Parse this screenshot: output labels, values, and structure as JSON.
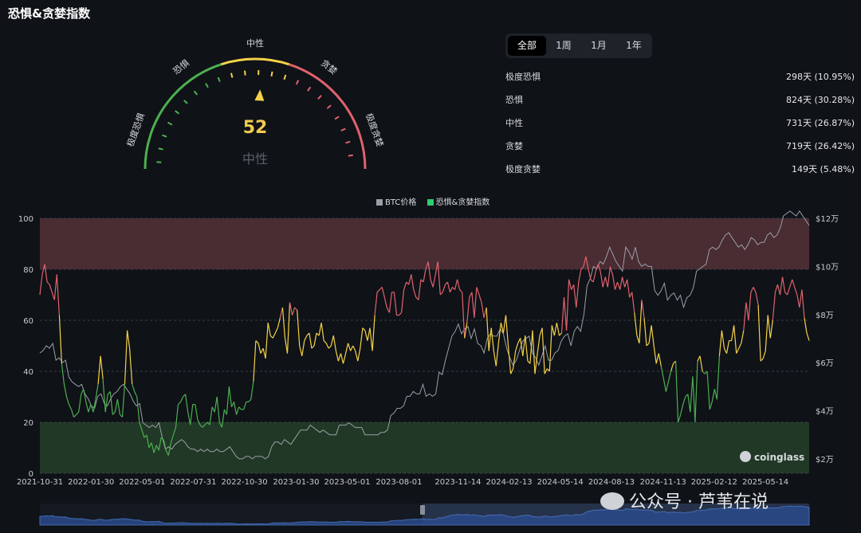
{
  "title": "恐惧&贪婪指数",
  "gauge": {
    "value": "52",
    "status": "中性",
    "labels": [
      "极度恐惧",
      "恐惧",
      "中性",
      "贪婪",
      "极度贪婪"
    ],
    "colors": {
      "extreme_fear": "#4caf50",
      "fear": "#4caf50",
      "neutral": "#f5d247",
      "greed": "#e0626e",
      "extreme_greed": "#e0626e"
    }
  },
  "tabs": [
    "全部",
    "1周",
    "1月",
    "1年"
  ],
  "active_tab": "全部",
  "stats": [
    {
      "label": "极度恐惧",
      "value": "298天 (10.95%)"
    },
    {
      "label": "恐惧",
      "value": "824天 (30.28%)"
    },
    {
      "label": "中性",
      "value": "731天 (26.87%)"
    },
    {
      "label": "贪婪",
      "value": "719天 (26.42%)"
    },
    {
      "label": "极度贪婪",
      "value": "149天 (5.48%)"
    }
  ],
  "chart_data": {
    "type": "line",
    "legend": [
      "BTC价格",
      "恐惧&贪婪指数"
    ],
    "y_left_ticks": [
      "100",
      "80",
      "60",
      "40",
      "20",
      "0"
    ],
    "y_left_range": [
      0,
      100
    ],
    "y_right_ticks": [
      "$12万",
      "$10万",
      "$8万",
      "$6万",
      "$4万",
      "$2万"
    ],
    "y_right_range": [
      10000,
      116000
    ],
    "x_ticks": [
      "2021-10-31",
      "2022-01-30",
      "2022-05-01",
      "2022-07-31",
      "2022-10-30",
      "2023-01-30",
      "2023-05-01",
      "2023-08-01",
      "2023-11-14",
      "2024-02-13",
      "2024-05-14",
      "2024-08-13",
      "2024-11-13",
      "2025-02-12",
      "2025-05-14"
    ],
    "zones": [
      {
        "name": "greed",
        "from": 80,
        "to": 100,
        "color": "#4a2c33"
      },
      {
        "name": "fear",
        "from": 0,
        "to": 20,
        "color": "#213826"
      }
    ],
    "index_colors": {
      "fear": "#4caf50",
      "neutral": "#f5d247",
      "greed": "#e0626e"
    },
    "fgi_series": {
      "name": "恐惧&贪婪指数",
      "values": [
        70,
        78,
        82,
        75,
        74,
        71,
        68,
        78,
        62,
        43,
        35,
        30,
        27,
        25,
        22,
        23,
        24,
        31,
        33,
        28,
        24,
        27,
        24,
        29,
        35,
        46,
        37,
        24,
        31,
        32,
        23,
        24,
        29,
        23,
        22,
        35,
        56,
        49,
        35,
        32,
        30,
        20,
        17,
        14,
        15,
        10,
        12,
        8,
        11,
        9,
        14,
        13,
        9,
        7,
        12,
        15,
        18,
        27,
        28,
        30,
        31,
        24,
        19,
        27,
        27,
        21,
        19,
        18,
        19,
        20,
        19,
        26,
        24,
        30,
        20,
        18,
        25,
        23,
        34,
        26,
        28,
        23,
        26,
        25,
        25,
        28,
        28,
        29,
        36,
        52,
        51,
        47,
        49,
        45,
        59,
        54,
        53,
        55,
        57,
        61,
        65,
        53,
        47,
        67,
        62,
        65,
        64,
        50,
        46,
        52,
        54,
        55,
        49,
        50,
        55,
        54,
        59,
        52,
        51,
        49,
        50,
        54,
        48,
        44,
        47,
        43,
        47,
        51,
        48,
        50,
        48,
        44,
        49,
        57,
        56,
        52,
        57,
        48,
        62,
        71,
        72,
        73,
        69,
        65,
        63,
        71,
        71,
        62,
        62,
        63,
        72,
        75,
        74,
        78,
        72,
        69,
        68,
        76,
        75,
        80,
        83,
        76,
        73,
        78,
        83,
        70,
        71,
        74,
        75,
        71,
        73,
        72,
        76,
        72,
        71,
        53,
        59,
        69,
        71,
        61,
        73,
        70,
        67,
        61,
        65,
        48,
        57,
        48,
        42,
        51,
        59,
        55,
        62,
        50,
        39,
        41,
        48,
        51,
        53,
        46,
        54,
        44,
        43,
        56,
        39,
        47,
        54,
        57,
        39,
        41,
        40,
        58,
        54,
        59,
        54,
        55,
        69,
        56,
        76,
        72,
        74,
        65,
        75,
        80,
        81,
        85,
        80,
        76,
        75,
        79,
        82,
        79,
        73,
        77,
        73,
        81,
        78,
        72,
        75,
        72,
        77,
        73,
        76,
        69,
        71,
        63,
        54,
        51,
        68,
        61,
        50,
        51,
        58,
        50,
        43,
        47,
        42,
        37,
        32,
        36,
        40,
        43,
        44,
        20,
        23,
        27,
        30,
        31,
        24,
        38,
        20,
        44,
        46,
        40,
        39,
        40,
        25,
        28,
        33,
        29,
        46,
        56,
        49,
        47,
        52,
        52,
        58,
        47,
        49,
        51,
        56,
        67,
        60,
        71,
        73,
        71,
        66,
        44,
        45,
        48,
        62,
        53,
        60,
        71,
        74,
        70,
        77,
        71,
        70,
        73,
        76,
        73,
        70,
        65,
        72,
        61,
        55,
        52
      ],
      "first_date": "2021-10-31",
      "last_date": "2025-07-31"
    },
    "btc_series": {
      "name": "BTC价格",
      "values": [
        60000,
        61000,
        63000,
        62000,
        64000,
        57000,
        58000,
        56000,
        57000,
        50000,
        48000,
        47000,
        46000,
        47000,
        43000,
        41000,
        38000,
        37000,
        42000,
        43000,
        39000,
        38000,
        41000,
        43000,
        44000,
        46000,
        47000,
        45000,
        43000,
        40000,
        38000,
        39000,
        31000,
        30000,
        29000,
        30000,
        29000,
        31000,
        25000,
        20000,
        21000,
        20000,
        22000,
        23000,
        24000,
        23000,
        21000,
        20000,
        20000,
        19000,
        20000,
        19000,
        20000,
        19000,
        19000,
        20000,
        19000,
        19000,
        20000,
        21000,
        19000,
        17000,
        16000,
        16000,
        17000,
        17000,
        16000,
        17000,
        17000,
        17000,
        16000,
        17000,
        21000,
        23000,
        23000,
        22000,
        24000,
        23000,
        22000,
        24000,
        26000,
        28000,
        28000,
        28000,
        30000,
        29000,
        28000,
        27000,
        28000,
        27000,
        26000,
        26000,
        26000,
        30000,
        30000,
        30000,
        31000,
        30000,
        29000,
        29000,
        29000,
        26000,
        26000,
        26000,
        26000,
        26000,
        27000,
        27000,
        28000,
        34000,
        35000,
        37000,
        37000,
        38000,
        42000,
        42000,
        44000,
        43000,
        43000,
        47000,
        42000,
        43000,
        42000,
        43000,
        52000,
        51000,
        57000,
        62000,
        67000,
        69000,
        72000,
        68000,
        70000,
        71000,
        66000,
        70000,
        64000,
        63000,
        60000,
        66000,
        68000,
        67000,
        67000,
        70000,
        68000,
        62000,
        58000,
        55000,
        57000,
        61000,
        65000,
        66000,
        67000,
        60000,
        58000,
        55000,
        59000,
        63000,
        57000,
        57000,
        60000,
        61000,
        65000,
        67000,
        68000,
        63000,
        69000,
        71000,
        69000,
        76000,
        88000,
        91000,
        96000,
        95000,
        98000,
        97000,
        100000,
        104000,
        101000,
        98000,
        96000,
        94000,
        104000,
        102000,
        99000,
        104000,
        98000,
        96000,
        97000,
        96000,
        96000,
        86000,
        84000,
        86000,
        89000,
        82000,
        84000,
        85000,
        82000,
        84000,
        79000,
        83000,
        84000,
        87000,
        94000,
        95000,
        96000,
        97000,
        103000,
        104000,
        103000,
        104000,
        107000,
        109000,
        110000,
        108000,
        106000,
        104000,
        105000,
        103000,
        105000,
        108000,
        107000,
        105000,
        106000,
        106000,
        109000,
        110000,
        108000,
        109000,
        112000,
        117000,
        118000,
        119000,
        118000,
        117000,
        119000,
        117000,
        115000,
        113000
      ]
    }
  },
  "watermark": "coinglass",
  "wechat_label": "公众号 · 芦苇在说"
}
